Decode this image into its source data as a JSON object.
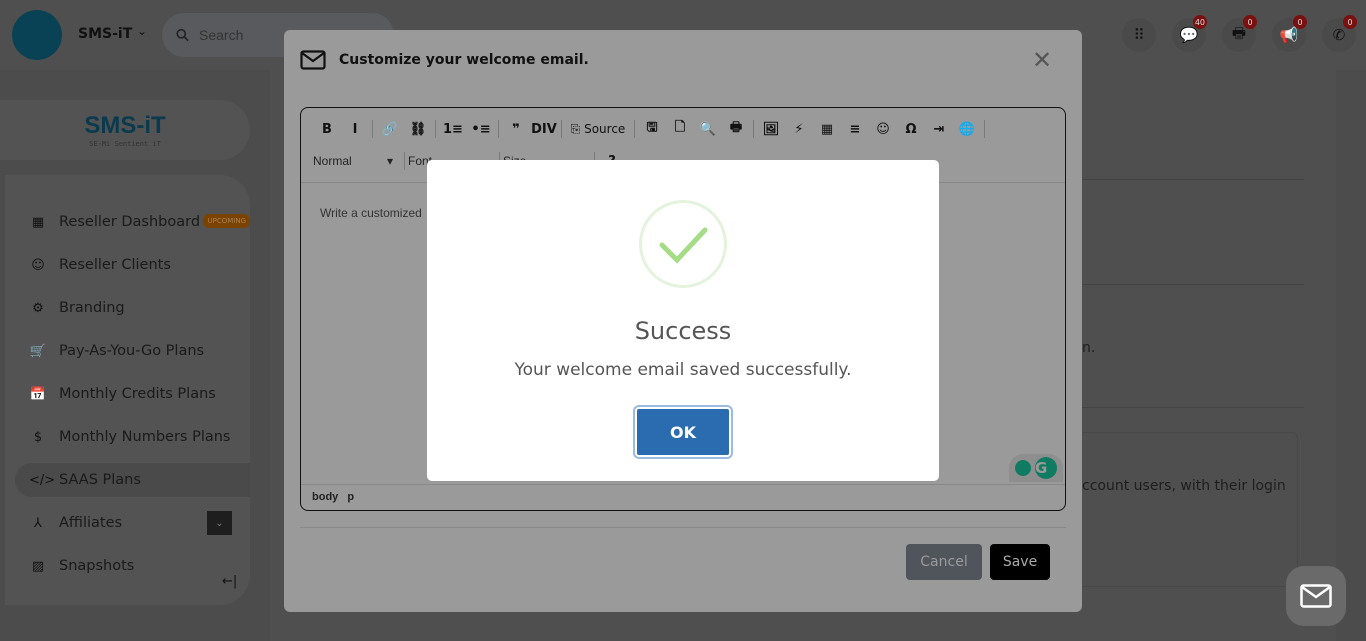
{
  "header": {
    "brand": "SMS-iT",
    "search_placeholder": "Search",
    "icons": [
      {
        "name": "apps-grid-icon",
        "glyph": "⠿",
        "badge": null
      },
      {
        "name": "chat-icon",
        "glyph": "💬",
        "badge": "40"
      },
      {
        "name": "fax-printer-icon",
        "glyph": "🖶",
        "badge": "0"
      },
      {
        "name": "megaphone-icon",
        "glyph": "📢",
        "badge": "0"
      },
      {
        "name": "phone-icon",
        "glyph": "✆",
        "badge": "0"
      }
    ]
  },
  "sidebar": {
    "logo": {
      "text": "SMS-iT",
      "tagline": "SE-Mi Sentient iT"
    },
    "items": [
      {
        "label": "Reseller Dashboard",
        "icon": "▦",
        "badge": "UPCOMING"
      },
      {
        "label": "Reseller Clients",
        "icon": "☺"
      },
      {
        "label": "Branding",
        "icon": "⚙"
      },
      {
        "label": "Pay-As-You-Go Plans",
        "icon": "🛒"
      },
      {
        "label": "Monthly Credits Plans",
        "icon": "📅"
      },
      {
        "label": "Monthly Numbers Plans",
        "icon": "$"
      },
      {
        "label": "SAAS Plans",
        "icon": "</>",
        "active": true
      },
      {
        "label": "Affiliates",
        "icon": "⅄"
      },
      {
        "label": "Snapshots",
        "icon": "▨"
      }
    ],
    "collapse_glyph": "←|"
  },
  "background": {
    "text1": "n.",
    "text2": "ccount users, with their login"
  },
  "modal": {
    "title": "Customize your welcome email.",
    "toolbar": {
      "row1": [
        "B",
        "I",
        "|",
        "🔗",
        "⛓",
        "|",
        "1≡",
        "•≡",
        "|",
        "❞",
        "DIV",
        "|",
        "⎘ Source",
        "|",
        "🖫",
        "🗋",
        "🔍",
        "🖶",
        "|",
        "🖼",
        "⚡",
        "▦",
        "≡",
        "☺",
        "Ω",
        "⇥",
        "🌐",
        "|"
      ],
      "format": "Normal",
      "font": "Font",
      "size": "Size"
    },
    "content": "Write a customized",
    "path": "body p",
    "cancel": "Cancel",
    "save": "Save"
  },
  "dialog": {
    "title": "Success",
    "message": "Your welcome email saved successfully.",
    "ok": "OK",
    "success_color": "#a5dc86",
    "ok_color": "#2b6cb0"
  }
}
